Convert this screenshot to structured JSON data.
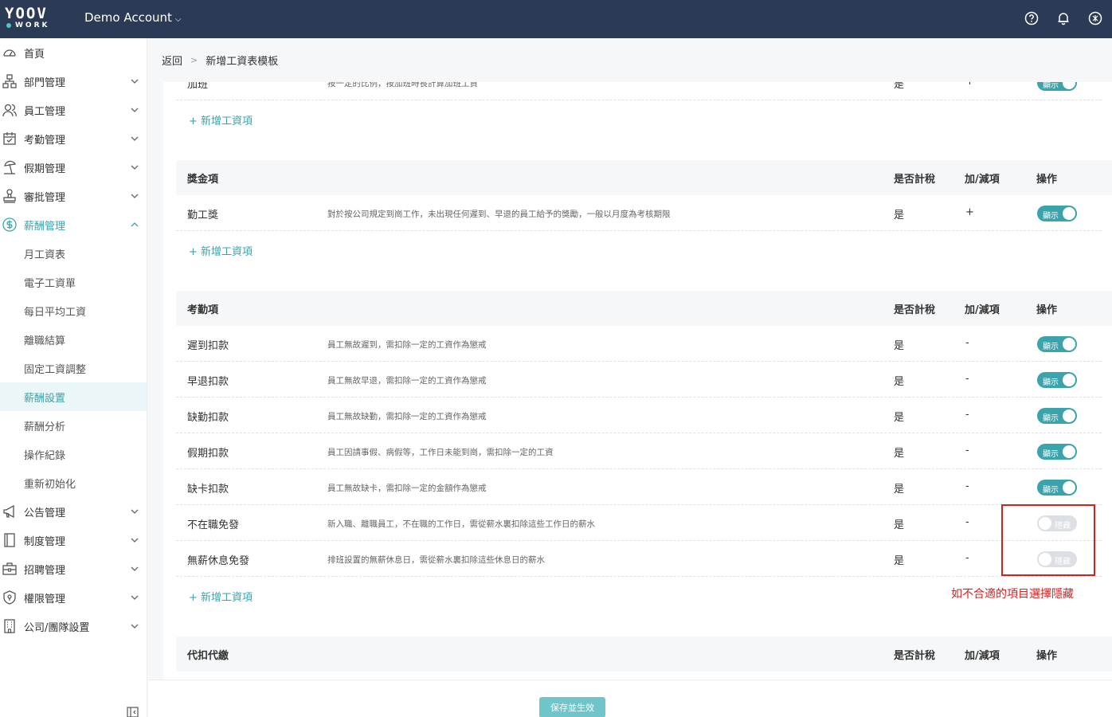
{
  "app": {
    "logo_top": "YOOV",
    "logo_bottom": "WORK",
    "account": "Demo Account"
  },
  "sidebar": {
    "items": [
      {
        "label": "首頁",
        "icon": "dashboard-icon"
      },
      {
        "label": "部門管理",
        "icon": "org-chart-icon"
      },
      {
        "label": "員工管理",
        "icon": "users-icon"
      },
      {
        "label": "考勤管理",
        "icon": "calendar-icon"
      },
      {
        "label": "假期管理",
        "icon": "beach-icon"
      },
      {
        "label": "審批管理",
        "icon": "stamp-icon"
      },
      {
        "label": "薪酬管理",
        "icon": "dollar-icon"
      }
    ],
    "sub_items": [
      {
        "label": "月工資表"
      },
      {
        "label": "電子工資單"
      },
      {
        "label": "每日平均工資"
      },
      {
        "label": "離職結算"
      },
      {
        "label": "固定工資調整"
      },
      {
        "label": "薪酬設置"
      },
      {
        "label": "薪酬分析"
      },
      {
        "label": "操作紀錄"
      },
      {
        "label": "重新初始化"
      }
    ],
    "items_after": [
      {
        "label": "公告管理",
        "icon": "megaphone-icon"
      },
      {
        "label": "制度管理",
        "icon": "book-icon"
      },
      {
        "label": "招聘管理",
        "icon": "briefcase-icon"
      },
      {
        "label": "權限管理",
        "icon": "shield-icon"
      },
      {
        "label": "公司/團隊設置",
        "icon": "building-icon"
      }
    ]
  },
  "breadcrumb": {
    "back": "返回",
    "current": "新增工資表模板"
  },
  "columns": {
    "tax": "是否計稅",
    "plus_minus": "加/減項",
    "action": "操作"
  },
  "partial_row": {
    "name": "加班",
    "desc": "按一定的比例，按加班時長計算加班工資",
    "tax": "是",
    "plus_minus": "+",
    "toggle": "顯示"
  },
  "add_item": "+ 新增工資項",
  "bonus_section": {
    "title": "獎金項",
    "rows": [
      {
        "name": "勤工獎",
        "desc": "對於按公司規定到崗工作，未出現任何遲到、早退的員工給予的獎勵，一般以月度為考核期限",
        "tax": "是",
        "plus_minus": "+",
        "toggle": "顯示"
      }
    ]
  },
  "attendance_section": {
    "title": "考勤項",
    "rows": [
      {
        "name": "遲到扣款",
        "desc": "員工無故遲到，需扣除一定的工資作為懲戒",
        "tax": "是",
        "plus_minus": "-",
        "toggle": "顯示"
      },
      {
        "name": "早退扣款",
        "desc": "員工無故早退，需扣除一定的工資作為懲戒",
        "tax": "是",
        "plus_minus": "-",
        "toggle": "顯示"
      },
      {
        "name": "缺勤扣款",
        "desc": "員工無故缺勤，需扣除一定的工資作為懲戒",
        "tax": "是",
        "plus_minus": "-",
        "toggle": "顯示"
      },
      {
        "name": "假期扣款",
        "desc": "員工因請事假、病假等，工作日未能到崗，需扣除一定的工資",
        "tax": "是",
        "plus_minus": "-",
        "toggle": "顯示"
      },
      {
        "name": "缺卡扣款",
        "desc": "員工無故缺卡，需扣除一定的金額作為懲戒",
        "tax": "是",
        "plus_minus": "-",
        "toggle": "顯示"
      },
      {
        "name": "不在職免發",
        "desc": "新入職、離職員工，不在職的工作日，需從薪水裏扣除這些工作日的薪水",
        "tax": "是",
        "plus_minus": "-",
        "toggle": "隱藏"
      },
      {
        "name": "無薪休息免發",
        "desc": "排班設置的無薪休息日，需從薪水裏扣除這些休息日的薪水",
        "tax": "是",
        "plus_minus": "-",
        "toggle": "隱藏"
      }
    ]
  },
  "withholding_section": {
    "title": "代扣代繳"
  },
  "annotation": "如不合適的項目選擇隱藏",
  "footer": {
    "save": "保存並生效"
  },
  "colors": {
    "topbar": "#2b3b55",
    "accent": "#3aa3ab",
    "annotation": "#d81e1e"
  }
}
